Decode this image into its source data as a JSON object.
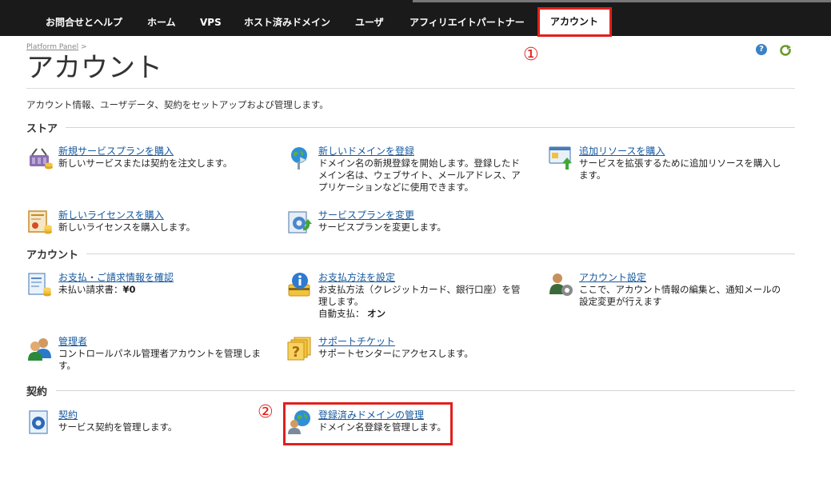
{
  "nav": {
    "items": [
      "お問合せとヘルプ",
      "ホーム",
      "VPS",
      "ホスト済みドメイン",
      "ユーザ",
      "アフィリエイトパートナー",
      "アカウント"
    ],
    "active_index": 6
  },
  "annotations": {
    "marker1": "①",
    "marker2": "②"
  },
  "breadcrumb": {
    "link": "Platform Panel",
    "sep": ">"
  },
  "page": {
    "title": "アカウント",
    "description": "アカウント情報、ユーザデータ、契約をセットアップおよび管理します。",
    "help_glyph": "?"
  },
  "sections": {
    "store": "ストア",
    "account": "アカウント",
    "contract": "契約"
  },
  "tools": {
    "buy_plan": {
      "link": "新規サービスプランを購入",
      "desc": [
        "新しいサービスまたは契約を注文します。"
      ]
    },
    "register_domain": {
      "link": "新しいドメインを登録",
      "desc": [
        "ドメイン名の新規登録を開始します。登録したド",
        "メイン名は、ウェブサイト、メールアドレス、ア",
        "プリケーションなどに使用できます。"
      ]
    },
    "buy_resources": {
      "link": "追加リソースを購入",
      "desc": [
        "サービスを拡張するために追加リソースを購入し",
        "ます。"
      ]
    },
    "buy_license": {
      "link": "新しいライセンスを購入",
      "desc": [
        "新しいライセンスを購入します。"
      ]
    },
    "change_plan": {
      "link": "サービスプランを変更",
      "desc": [
        "サービスプランを変更します。"
      ]
    },
    "billing": {
      "link": "お支払・ご請求情報を確認",
      "desc": [
        "未払い請求書：",
        "¥0"
      ]
    },
    "payment_method": {
      "link": "お支払方法を設定",
      "desc": [
        "お支払方法（クレジットカード、銀行口座）を管",
        "理します。",
        "自動支払：",
        "オン"
      ]
    },
    "account_settings": {
      "link": "アカウント設定",
      "desc": [
        "ここで、アカウント情報の編集と、通知メールの",
        "設定変更が行えます"
      ]
    },
    "admins": {
      "link": "管理者",
      "desc": [
        "コントロールパネル管理者アカウントを管理しま",
        "す。"
      ]
    },
    "support": {
      "link": "サポートチケット",
      "desc": [
        "サポートセンターにアクセスします。"
      ]
    },
    "contracts": {
      "link": "契約",
      "desc": [
        "サービス契約を管理します。"
      ]
    },
    "registered_domains": {
      "link": "登録済みドメインの管理",
      "desc": [
        "ドメイン名登録を管理します。"
      ]
    }
  },
  "colors": {
    "nav_bg": "#1a1a1a",
    "link": "#14589e",
    "highlight": "#e0201c"
  }
}
